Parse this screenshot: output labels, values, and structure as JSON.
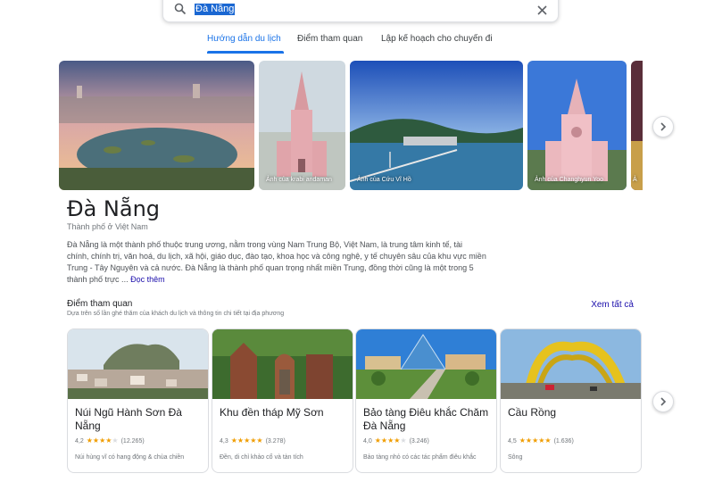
{
  "search": {
    "query": "Đà Nẵng"
  },
  "tabs": [
    {
      "label": "Hướng dẫn du lịch",
      "active": true
    },
    {
      "label": "Điểm tham quan",
      "active": false
    },
    {
      "label": "Lập kế hoạch cho chuyến đi",
      "active": false
    }
  ],
  "photos": [
    {
      "credit": ""
    },
    {
      "credit": "Ảnh của krabi andaman"
    },
    {
      "credit": "Ảnh của Cứu Vĩ Hồ"
    },
    {
      "credit": "Ảnh của Changhyun Yoo"
    },
    {
      "credit": "Ả"
    }
  ],
  "place": {
    "title": "Đà Nẵng",
    "subtitle": "Thành phố ở Việt Nam",
    "description": "Đà Nẵng là một thành phố thuộc trung ương, nằm trong vùng Nam Trung Bộ, Việt Nam, là trung tâm kinh tế, tài chính, chính trị, văn hoá, du lịch, xã hội, giáo dục, đào tạo, khoa học và công nghệ, y tế chuyên sâu của khu vực miền Trung - Tây Nguyên và cả nước. Đà Nẵng là thành phố quan trọng nhất miền Trung, đồng thời cũng là một trong 5 thành phố trực ...",
    "more_label": "Đọc thêm"
  },
  "attractions": {
    "title": "Điểm tham quan",
    "subtitle": "Dựa trên số lần ghé thăm của khách du lịch và thông tin chi tiết tại địa phương",
    "see_all": "Xem tất cả",
    "cards": [
      {
        "name": "Núi Ngũ Hành Sơn Đà Nẵng",
        "rating": "4,2",
        "stars": 4,
        "reviews": "(12.265)",
        "desc": "Núi hùng vĩ có hang động & chùa chiền"
      },
      {
        "name": "Khu đền tháp Mỹ Sơn",
        "rating": "4,3",
        "stars": 4.5,
        "reviews": "(3.278)",
        "desc": "Đền, di chỉ khảo cổ và tàn tích"
      },
      {
        "name": "Bảo tàng Điêu khắc Chăm Đà Nẵng",
        "rating": "4,0",
        "stars": 4,
        "reviews": "(3.246)",
        "desc": "Bảo tàng nhỏ có các tác phẩm điêu khắc"
      },
      {
        "name": "Cầu Rồng",
        "rating": "4,5",
        "stars": 4.5,
        "reviews": "(1.636)",
        "desc": "Sông"
      }
    ]
  },
  "icons": {
    "search": "search-icon",
    "clear": "close-icon",
    "next": "chevron-right-icon"
  },
  "colors": {
    "accent": "#1a73e8",
    "link": "#1a0dab",
    "star": "#f09d00"
  }
}
